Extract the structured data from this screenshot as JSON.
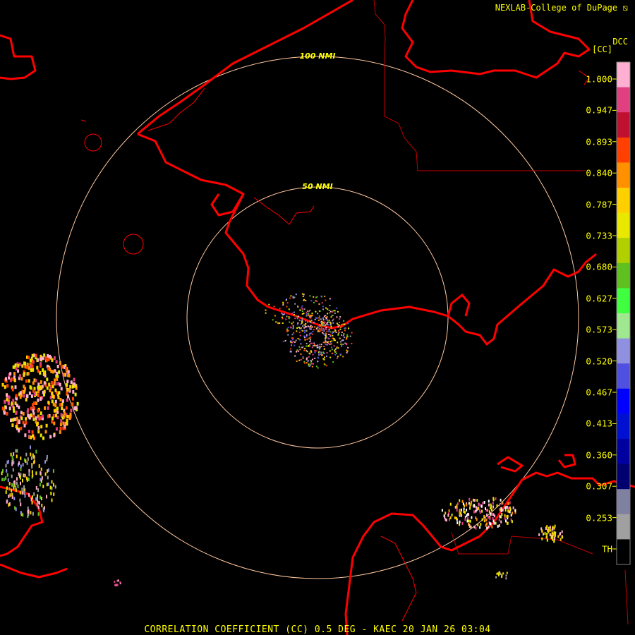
{
  "header": {
    "credit": "NEXLAB-College of DuPage",
    "credit_mark": "⧅"
  },
  "legend": {
    "product_id": "DCC",
    "unit": "[CC]",
    "labels": [
      "1.000",
      "0.947",
      "0.893",
      "0.840",
      "0.787",
      "0.733",
      "0.680",
      "0.627",
      "0.573",
      "0.520",
      "0.467",
      "0.413",
      "0.360",
      "0.307",
      "0.253",
      "TH"
    ],
    "color_scale": [
      "#ffb0d0",
      "#e04080",
      "#c01030",
      "#ff4000",
      "#ff9000",
      "#ffd000",
      "#e8e800",
      "#b0d000",
      "#60c020",
      "#40ff40",
      "#a0e890",
      "#9090e0",
      "#5050e0",
      "#0000ff",
      "#0010d0",
      "#0000a0",
      "#000070",
      "#8080a0",
      "#a0a0a0",
      "#000000"
    ]
  },
  "range_rings": {
    "inner_label": "50 NMI",
    "outer_label": "100 NMI"
  },
  "caption": "CORRELATION COEFFICIENT (CC) 0.5 DEG - KAEC 20 JAN 26 03:04",
  "colors": {
    "coastline": "#ff0000",
    "ring": "#ffc8a0",
    "text": "#ffff00",
    "border": "#c00000"
  }
}
